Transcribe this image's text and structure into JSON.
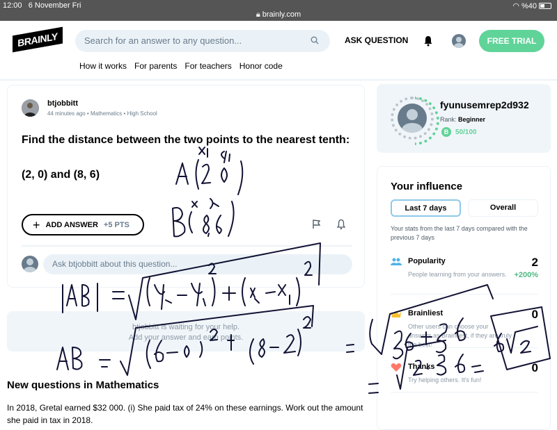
{
  "status_bar": {
    "time": "12:00",
    "date": "6 November Fri",
    "url": "brainly.com",
    "battery": "%40"
  },
  "header": {
    "logo": "BRAINLY",
    "search_placeholder": "Search for an answer to any question...",
    "ask_question": "ASK QUESTION",
    "free_trial": "FREE TRIAL",
    "nav": [
      "How it works",
      "For parents",
      "For teachers",
      "Honor code"
    ]
  },
  "question": {
    "author": "btjobbitt",
    "time_ago": "44 minutes ago",
    "subject": "Mathematics",
    "level": "High School",
    "text_line1": "Find the distance between the two points to the nearest tenth:",
    "text_line2": "(2, 0) and (8, 6)",
    "add_answer": "ADD ANSWER",
    "points": "+5 PTS",
    "comment_placeholder": "Ask btjobbitt about this question..."
  },
  "waiting": {
    "line1": "btjobbitt is waiting for your help.",
    "line2": "Add your answer and earn points."
  },
  "new_questions": {
    "title": "New questions in Mathematics",
    "items": [
      "In 2018, Gretal earned $32 000. (i) She paid tax of 24% on these earnings. Work out the amount she paid in tax in 2018."
    ]
  },
  "profile": {
    "username": "fyunusemrep2d932",
    "rank_label": "Rank:",
    "rank": "Beginner",
    "badge": "B",
    "points": "50/100",
    "progress": 0.5
  },
  "influence": {
    "title": "Your influence",
    "tab_active": "Last 7 days",
    "tab_inactive": "Overall",
    "description": "Your stats from the last 7 days compared with the previous 7 days",
    "stats": [
      {
        "title": "Popularity",
        "desc": "People learning from your answers.",
        "value": "2",
        "change": "+200%",
        "icon": "people-icon",
        "color": "#4fb3e8"
      },
      {
        "title": "Brainliest",
        "desc": "Other users can choose your answers as Brainliest, if they are truly the best!",
        "value": "0",
        "change": "",
        "icon": "crown-icon",
        "color": "#fbbe2e"
      },
      {
        "title": "Thanks",
        "desc": "Try helping others. It's fun!",
        "value": "0",
        "change": "",
        "icon": "heart-icon",
        "color": "#ff7968"
      }
    ]
  },
  "colors": {
    "accent_green": "#60d399",
    "light_bg": "#ebf2f7",
    "gray_text": "#687b8c"
  }
}
